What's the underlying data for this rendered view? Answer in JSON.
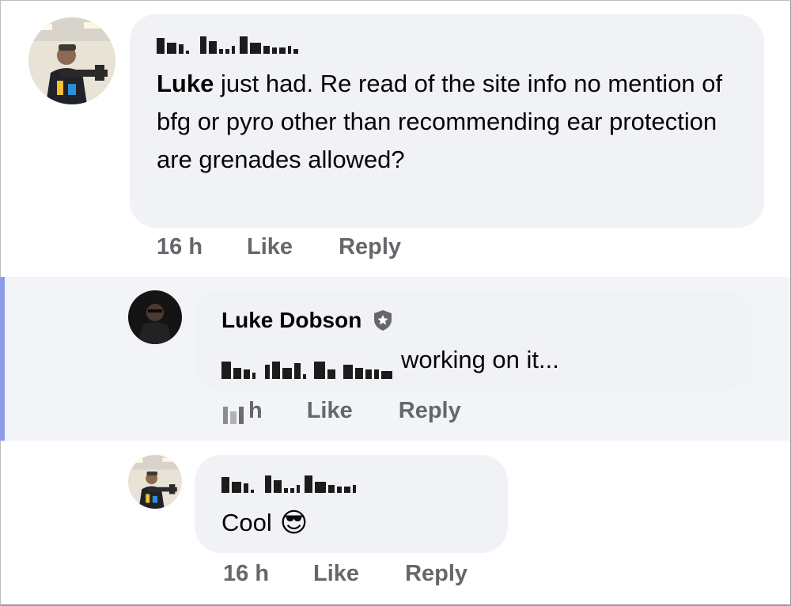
{
  "comments": [
    {
      "author": "",
      "mention": "Luke",
      "text": " just had. Re read of the site info no mention of bfg or pyro other than recommending ear protection are grenades allowed?",
      "time": "16 h",
      "like_label": "Like",
      "reply_label": "Reply",
      "avatar_icon": "profile-photo-soldier"
    },
    {
      "author": "Luke Dobson",
      "badge_icon": "shield-star-badge-icon",
      "text": "working on it...",
      "time_suffix": "h",
      "like_label": "Like",
      "reply_label": "Reply",
      "avatar_icon": "profile-photo-dark"
    },
    {
      "author": "",
      "text": "Cool",
      "emoji": "😎",
      "time": "16 h",
      "like_label": "Like",
      "reply_label": "Reply",
      "avatar_icon": "profile-photo-soldier"
    }
  ],
  "colors": {
    "bubble": "#f0f2f5",
    "meta_text": "#65676b",
    "highlight_bar": "#8c9be6"
  }
}
